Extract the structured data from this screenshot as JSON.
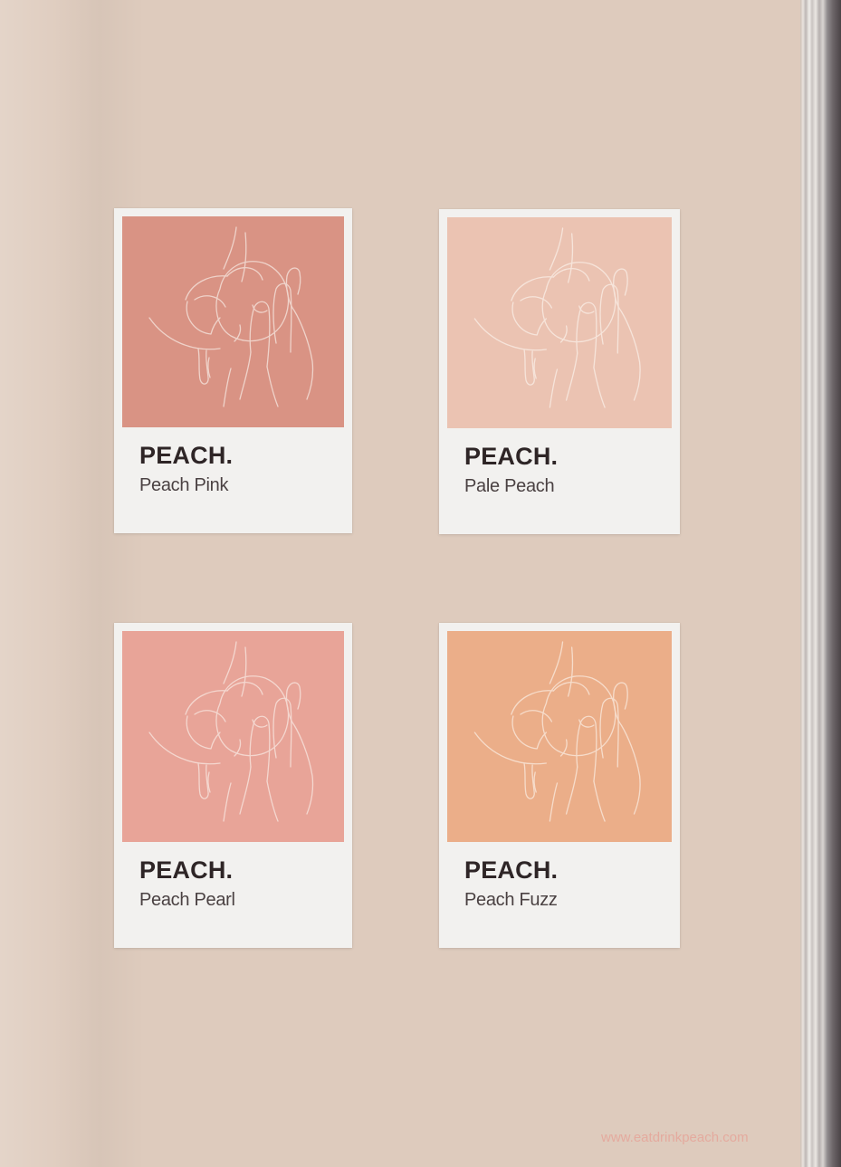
{
  "cards": [
    {
      "brand": "PEACH.",
      "name": "Peach Pink",
      "color": "#d99384",
      "line_color": "#f2dad2"
    },
    {
      "brand": "PEACH.",
      "name": "Pale Peach",
      "color": "#ebc3b2",
      "line_color": "#f8e8df"
    },
    {
      "brand": "PEACH.",
      "name": "Peach Pearl",
      "color": "#e8a498",
      "line_color": "#f6ddd6"
    },
    {
      "brand": "PEACH.",
      "name": "Peach Fuzz",
      "color": "#ebae89",
      "line_color": "#f8e1d2"
    }
  ],
  "illustration": {
    "icon": "hand-holding-peach-line-art-icon"
  },
  "footer": {
    "website": "www.eatdrinkpeach.com"
  }
}
